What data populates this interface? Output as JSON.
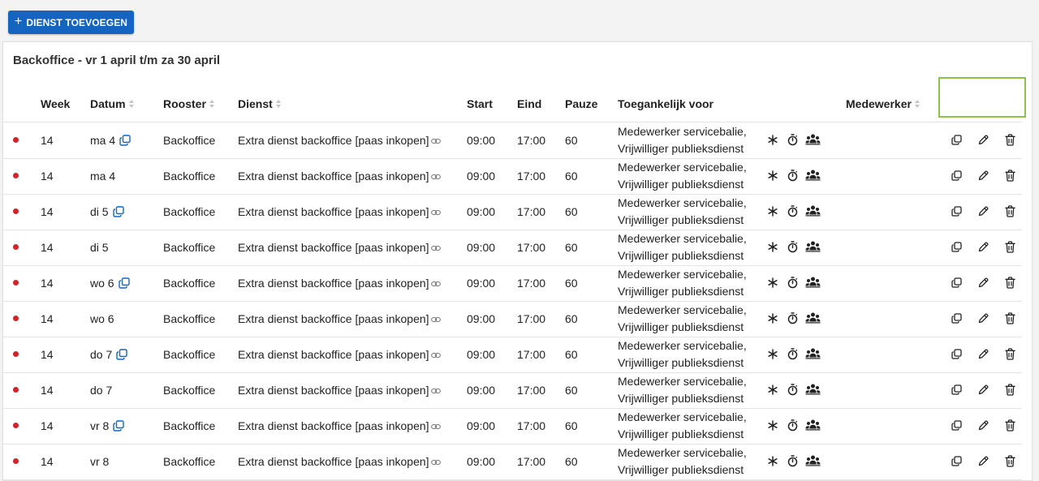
{
  "add_button": {
    "label": "DIENST TOEVOEGEN"
  },
  "card": {
    "title": "Backoffice - vr 1 april t/m za 30 april",
    "columns": {
      "week": "Week",
      "datum": "Datum",
      "rooster": "Rooster",
      "dienst": "Dienst",
      "start": "Start",
      "eind": "Eind",
      "pauze": "Pauze",
      "toegankelijk": "Toegankelijk voor",
      "medewerker": "Medewerker"
    },
    "rows": [
      {
        "week": "14",
        "datum": "ma 4",
        "has_copy": true,
        "rooster": "Backoffice",
        "dienst": "Extra dienst backoffice [paas inkopen]",
        "start": "09:00",
        "eind": "17:00",
        "pauze": "60",
        "toeg_line1": "Medewerker servicebalie,",
        "toeg_line2": "Vrijwilliger publieksdienst",
        "medewerker": ""
      },
      {
        "week": "14",
        "datum": "ma 4",
        "has_copy": false,
        "rooster": "Backoffice",
        "dienst": "Extra dienst backoffice [paas inkopen]",
        "start": "09:00",
        "eind": "17:00",
        "pauze": "60",
        "toeg_line1": "Medewerker servicebalie,",
        "toeg_line2": "Vrijwilliger publieksdienst",
        "medewerker": ""
      },
      {
        "week": "14",
        "datum": "di 5",
        "has_copy": true,
        "rooster": "Backoffice",
        "dienst": "Extra dienst backoffice [paas inkopen]",
        "start": "09:00",
        "eind": "17:00",
        "pauze": "60",
        "toeg_line1": "Medewerker servicebalie,",
        "toeg_line2": "Vrijwilliger publieksdienst",
        "medewerker": ""
      },
      {
        "week": "14",
        "datum": "di 5",
        "has_copy": false,
        "rooster": "Backoffice",
        "dienst": "Extra dienst backoffice [paas inkopen]",
        "start": "09:00",
        "eind": "17:00",
        "pauze": "60",
        "toeg_line1": "Medewerker servicebalie,",
        "toeg_line2": "Vrijwilliger publieksdienst",
        "medewerker": ""
      },
      {
        "week": "14",
        "datum": "wo 6",
        "has_copy": true,
        "rooster": "Backoffice",
        "dienst": "Extra dienst backoffice [paas inkopen]",
        "start": "09:00",
        "eind": "17:00",
        "pauze": "60",
        "toeg_line1": "Medewerker servicebalie,",
        "toeg_line2": "Vrijwilliger publieksdienst",
        "medewerker": ""
      },
      {
        "week": "14",
        "datum": "wo 6",
        "has_copy": false,
        "rooster": "Backoffice",
        "dienst": "Extra dienst backoffice [paas inkopen]",
        "start": "09:00",
        "eind": "17:00",
        "pauze": "60",
        "toeg_line1": "Medewerker servicebalie,",
        "toeg_line2": "Vrijwilliger publieksdienst",
        "medewerker": ""
      },
      {
        "week": "14",
        "datum": "do 7",
        "has_copy": true,
        "rooster": "Backoffice",
        "dienst": "Extra dienst backoffice [paas inkopen]",
        "start": "09:00",
        "eind": "17:00",
        "pauze": "60",
        "toeg_line1": "Medewerker servicebalie,",
        "toeg_line2": "Vrijwilliger publieksdienst",
        "medewerker": ""
      },
      {
        "week": "14",
        "datum": "do 7",
        "has_copy": false,
        "rooster": "Backoffice",
        "dienst": "Extra dienst backoffice [paas inkopen]",
        "start": "09:00",
        "eind": "17:00",
        "pauze": "60",
        "toeg_line1": "Medewerker servicebalie,",
        "toeg_line2": "Vrijwilliger publieksdienst",
        "medewerker": ""
      },
      {
        "week": "14",
        "datum": "vr 8",
        "has_copy": true,
        "rooster": "Backoffice",
        "dienst": "Extra dienst backoffice [paas inkopen]",
        "start": "09:00",
        "eind": "17:00",
        "pauze": "60",
        "toeg_line1": "Medewerker servicebalie,",
        "toeg_line2": "Vrijwilliger publieksdienst",
        "medewerker": ""
      },
      {
        "week": "14",
        "datum": "vr 8",
        "has_copy": false,
        "rooster": "Backoffice",
        "dienst": "Extra dienst backoffice [paas inkopen]",
        "start": "09:00",
        "eind": "17:00",
        "pauze": "60",
        "toeg_line1": "Medewerker servicebalie,",
        "toeg_line2": "Vrijwilliger publieksdienst",
        "medewerker": ""
      }
    ]
  },
  "icons": {
    "add": "plus-icon",
    "sort": "sort-icon",
    "copy_date": "copy-icon",
    "link": "link-icon",
    "asterisk": "asterisk-icon",
    "timer": "stopwatch-icon",
    "group": "users-icon",
    "row_copy": "duplicate-icon",
    "edit": "pencil-icon",
    "delete": "trash-icon"
  },
  "colors": {
    "primary": "#1565c0",
    "status_dot": "#d3222a",
    "highlight": "#8bc34a",
    "link_icon": "#1565c0"
  }
}
